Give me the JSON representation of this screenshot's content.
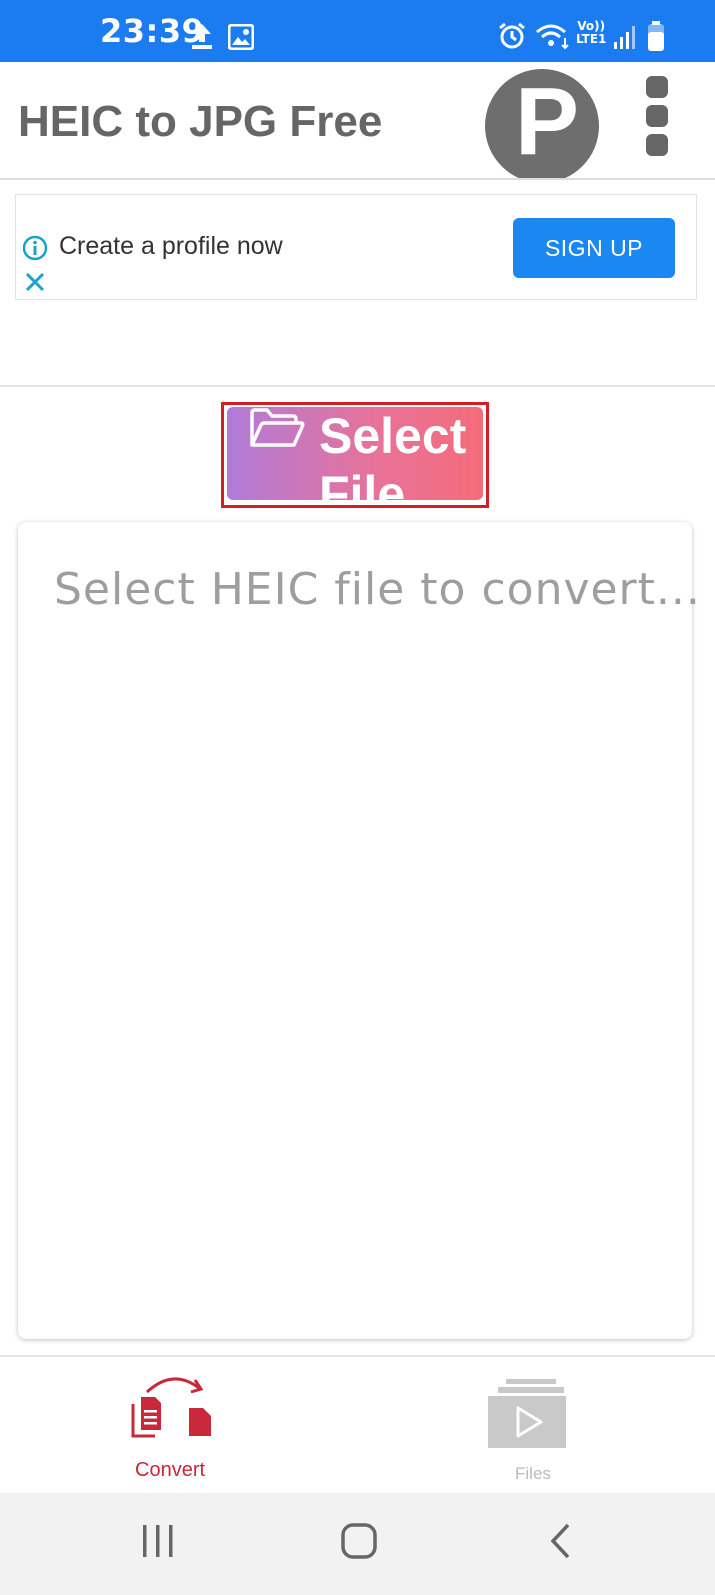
{
  "status_bar": {
    "time": "23:39",
    "left_icons": [
      "upload-icon",
      "gallery-icon"
    ],
    "right_icons": [
      "alarm-icon",
      "wifi-icon",
      "volte-lte-icon",
      "signal-icon",
      "battery-icon"
    ],
    "volte_text": "Vo))",
    "lte_text": "LTE1"
  },
  "app_bar": {
    "title": "HEIC to JPG Free",
    "avatar_letter": "P",
    "menu_icon": "more-vert-icon"
  },
  "ad": {
    "text": "Create a profile now",
    "button_label": "SIGN UP"
  },
  "select_button": {
    "label": "Select File",
    "icon": "folder-open-icon"
  },
  "content": {
    "placeholder": "Select HEIC file to convert..."
  },
  "bottom_nav": {
    "items": [
      {
        "label": "Convert",
        "icon": "convert-icon",
        "active": true
      },
      {
        "label": "Files",
        "icon": "files-icon",
        "active": false
      }
    ]
  },
  "colors": {
    "status_bar": "#1a7cf0",
    "accent_red": "#c8283a",
    "signup_blue": "#1a87f2",
    "gradient_start": "#b07bd9",
    "gradient_end": "#f56b7a"
  }
}
